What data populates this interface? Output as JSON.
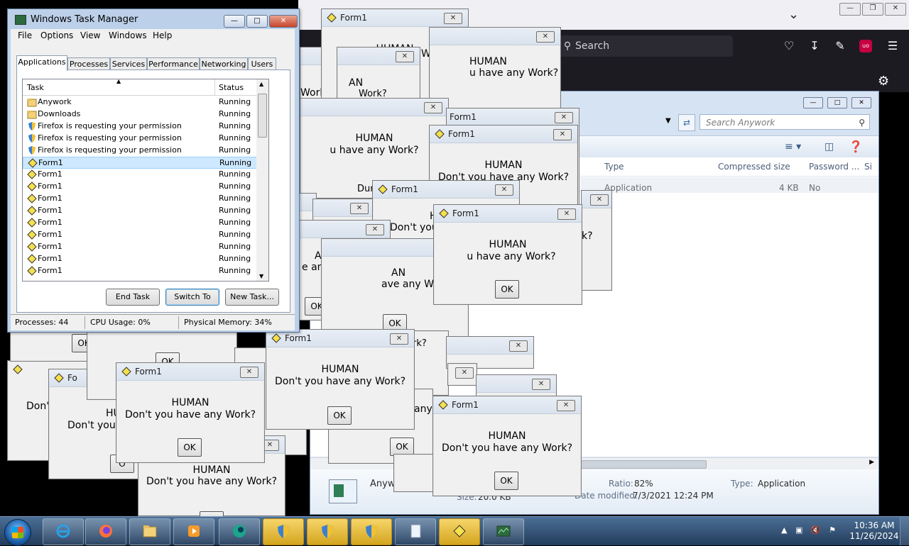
{
  "firefox": {
    "search_placeholder": "Search",
    "icons": [
      "chevron-down-icon",
      "pocket-icon",
      "download-icon",
      "extensions-icon",
      "ublock-icon",
      "menu-icon",
      "gear-icon"
    ],
    "ublock_label": "uo"
  },
  "explorer": {
    "search_placeholder": "Search Anywork",
    "columns": [
      "Type",
      "Compressed size",
      "Password ...",
      "Si"
    ],
    "row": {
      "type": "Application",
      "compressed_size": "4 KB",
      "password": "No"
    },
    "details": {
      "name": "Anyw",
      "ratio_label": "Ratio:",
      "ratio": "82%",
      "type_label": "Type:",
      "type": "Application",
      "size_label": "Size:",
      "size": "20.0 KB",
      "date_label": "Date modified:",
      "date": "7/3/2021 12:24 PM"
    }
  },
  "dialog": {
    "title": "Form1",
    "line1": "HUMAN",
    "line2": "Don't you have any Work?",
    "ok": "OK",
    "close": "✕"
  },
  "task_manager": {
    "title": "Windows Task Manager",
    "menu": [
      "File",
      "Options",
      "View",
      "Windows",
      "Help"
    ],
    "tabs": [
      "Applications",
      "Processes",
      "Services",
      "Performance",
      "Networking",
      "Users"
    ],
    "col_task": "Task",
    "col_status": "Status",
    "rows": [
      {
        "task": "Anywork",
        "status": "Running",
        "icon": "folder"
      },
      {
        "task": "Downloads",
        "status": "Running",
        "icon": "folder"
      },
      {
        "task": "Firefox is requesting your permission",
        "status": "Running",
        "icon": "shield"
      },
      {
        "task": "Firefox is requesting your permission",
        "status": "Running",
        "icon": "shield"
      },
      {
        "task": "Firefox is requesting your permission",
        "status": "Running",
        "icon": "shield"
      },
      {
        "task": "Form1",
        "status": "Running",
        "icon": "form"
      },
      {
        "task": "Form1",
        "status": "Running",
        "icon": "form"
      },
      {
        "task": "Form1",
        "status": "Running",
        "icon": "form"
      },
      {
        "task": "Form1",
        "status": "Running",
        "icon": "form"
      },
      {
        "task": "Form1",
        "status": "Running",
        "icon": "form"
      },
      {
        "task": "Form1",
        "status": "Running",
        "icon": "form"
      },
      {
        "task": "Form1",
        "status": "Running",
        "icon": "form"
      },
      {
        "task": "Form1",
        "status": "Running",
        "icon": "form"
      },
      {
        "task": "Form1",
        "status": "Running",
        "icon": "form"
      },
      {
        "task": "Form1",
        "status": "Running",
        "icon": "form"
      }
    ],
    "buttons": {
      "end_task": "End Task",
      "switch_to": "Switch To",
      "new_task": "New Task..."
    },
    "status": {
      "processes": "Processes: 44",
      "cpu": "CPU Usage: 0%",
      "memory": "Physical Memory: 34%"
    }
  },
  "partial_texts": {
    "work_q": "Work?",
    "no_work": "e any Work?",
    "ave_work": "ave any Work?",
    "u_have": "u have any Work?",
    "dont_you_hn": "Don't you h",
    "dont_t": "Don't",
    "dont_you_l": "Don't you l",
    "dur": "Dur",
    "any": "any",
    "rk_q": "rk?",
    "k_q": "k?",
    "hu": "HU",
    "h": "H",
    "an": "AN",
    "fo": "Fo",
    "o": "O",
    "ok": "OK"
  },
  "taskbar": {
    "clock_time": "10:36 AM",
    "clock_date": "11/26/2024",
    "buttons": [
      "internet-explorer-icon",
      "firefox-icon",
      "explorer-folder-icon",
      "media-player-icon",
      "app-icon",
      "uac-shield-icon",
      "uac-shield-icon",
      "uac-shield-icon",
      "document-icon",
      "form1-icon",
      "task-manager-icon"
    ]
  }
}
